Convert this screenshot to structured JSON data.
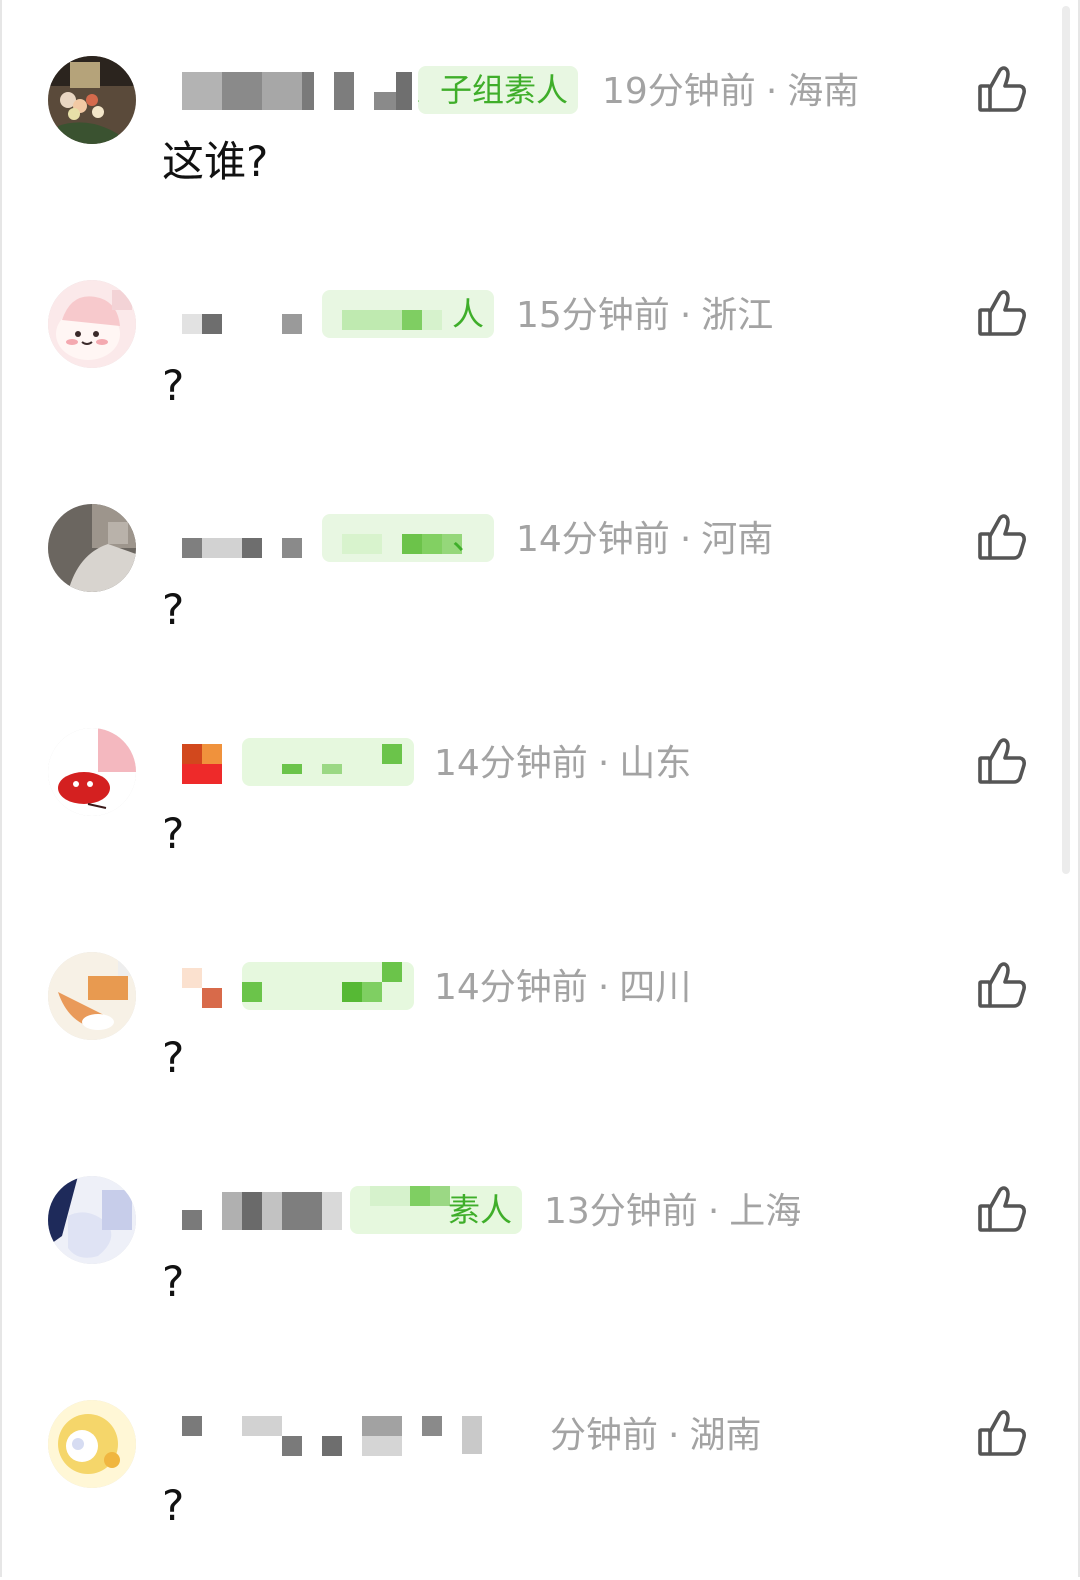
{
  "comments": [
    {
      "id": "c1",
      "badge_text": "、子组素人",
      "time": "19分钟前",
      "location": "海南",
      "text": "这谁?",
      "avatar_icon": "avatar-flowers-icon"
    },
    {
      "id": "c2",
      "badge_text": "人",
      "time": "15分钟前",
      "location": "浙江",
      "text": "?",
      "avatar_icon": "avatar-pink-cartoon-icon"
    },
    {
      "id": "c3",
      "badge_text": "、",
      "time": "14分钟前",
      "location": "河南",
      "text": "?",
      "avatar_icon": "avatar-photo-icon"
    },
    {
      "id": "c4",
      "badge_text": "",
      "time": "14分钟前",
      "location": "山东",
      "text": "?",
      "avatar_icon": "avatar-red-cartoon-icon"
    },
    {
      "id": "c5",
      "badge_text": "",
      "time": "14分钟前",
      "location": "四川",
      "text": "?",
      "avatar_icon": "avatar-cream-cartoon-icon"
    },
    {
      "id": "c6",
      "badge_text": "素人",
      "time": "13分钟前",
      "location": "上海",
      "text": "?",
      "avatar_icon": "avatar-blue-photo-icon"
    },
    {
      "id": "c7",
      "badge_text": "",
      "time": "分钟前",
      "location": "湖南",
      "text": "?",
      "avatar_icon": "avatar-yellow-cartoon-icon"
    }
  ],
  "separator": "·",
  "colors": {
    "meta_text": "#a3a3a3",
    "badge_bg": "#e8f7e2",
    "badge_text": "#3fae2a",
    "comment_text": "#111111",
    "icon_stroke": "#555555"
  },
  "like_icon": "thumbs-up-icon"
}
